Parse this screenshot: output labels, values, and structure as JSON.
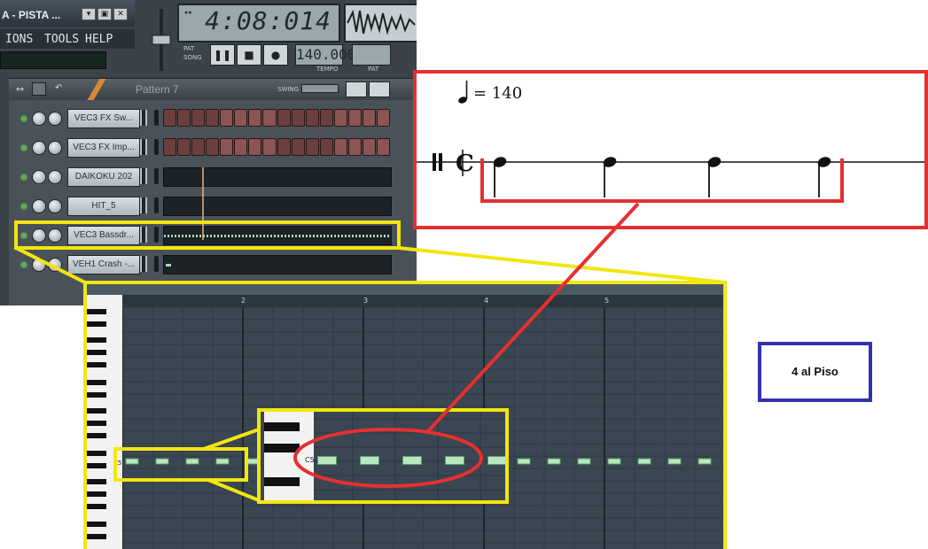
{
  "window": {
    "title": "A - PISTA ...",
    "buttons": [
      "▾",
      "▣",
      "✕"
    ],
    "menu": [
      "IONS",
      "TOOLS",
      "HELP"
    ]
  },
  "clock": {
    "time": "4:08:014"
  },
  "transport": {
    "pat_label": "PAT",
    "song_label": "SONG",
    "tempo_value": "140.000",
    "tempo_label": "TEMPO",
    "pat_box_label": "PAT"
  },
  "sequencer": {
    "pattern": "Pattern 7",
    "swing_label": "SWING",
    "channels": [
      {
        "name": "VEC3 FX Sw..."
      },
      {
        "name": "VEC3 FX Imp..."
      },
      {
        "name": "DAIKOKU 202"
      },
      {
        "name": "HIT_5"
      },
      {
        "name": "VEC3 Bassdr..."
      },
      {
        "name": "VEH1 Crash -..."
      }
    ]
  },
  "piano_roll": {
    "ruler": [
      "2",
      "3",
      "4",
      "5"
    ],
    "note_label": "C5"
  },
  "notation": {
    "tempo_mark": "= 140"
  },
  "caption": {
    "text": "4 al Piso"
  },
  "colors": {
    "highlight_yellow": "#f2e60f",
    "highlight_red": "#e53030",
    "caption_blue": "#3232ad",
    "note_green": "#b8e8c0"
  }
}
